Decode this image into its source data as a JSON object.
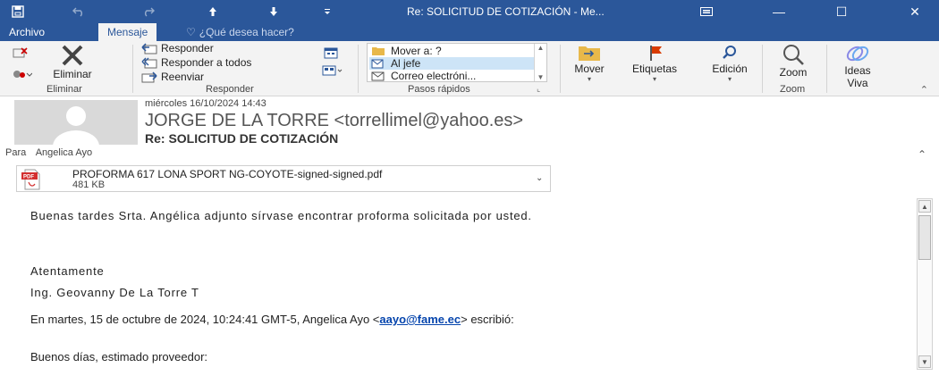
{
  "titlebar": {
    "title": "Re: SOLICITUD DE COTIZACIÓN - Me...",
    "save_icon": "save-icon",
    "undo_icon": "undo-icon",
    "redo_icon": "redo-icon",
    "prev_icon": "arrow-up-icon",
    "next_icon": "arrow-down-icon",
    "qat_icon": "customize-qat-icon",
    "ribbon_display_icon": "ribbon-display-icon",
    "minimize": "—",
    "maximize": "☐",
    "close": "✕"
  },
  "tabs": {
    "archivo": "Archivo",
    "mensaje": "Mensaje",
    "tell_me": "¿Qué desea hacer?"
  },
  "ribbon": {
    "eliminar": {
      "ignore_icon": "ignore-icon",
      "junk_icon": "junk-icon",
      "delete_label": "Eliminar",
      "group_label": "Eliminar"
    },
    "responder": {
      "reply": "Responder",
      "reply_all": "Responder a todos",
      "forward": "Reenviar",
      "group_label": "Responder"
    },
    "pasos_rapidos": {
      "items": [
        "Mover a: ?",
        "Al jefe",
        "Correo electróni..."
      ],
      "group_label": "Pasos rápidos"
    },
    "mover": {
      "label": "Mover"
    },
    "etiquetas": {
      "label": "Etiquetas"
    },
    "edicion": {
      "label": "Edición"
    },
    "zoom": {
      "label": "Zoom",
      "group_label": "Zoom"
    },
    "ideas": {
      "label1": "Ideas",
      "label2": "Viva"
    }
  },
  "header": {
    "date": "miércoles 16/10/2024 14:43",
    "sender": "JORGE DE LA TORRE <torrellimel@yahoo.es>",
    "subject": "Re: SOLICITUD DE COTIZACIÓN",
    "to_label": "Para",
    "to_value": "Angelica Ayo"
  },
  "attachment": {
    "name": "PROFORMA 617 LONA SPORT NG-COYOTE-signed-signed.pdf",
    "size": "481 KB",
    "badge": "PDF"
  },
  "body": {
    "line1": "Buenas tardes Srta. Angélica adjunto sírvase encontrar proforma solicitada por usted.",
    "line2": "Atentamente",
    "line3": "Ing. Geovanny De La Torre T",
    "line4_prefix": "En martes, 15 de octubre de 2024, 10:24:41 GMT-5, Angelica Ayo <",
    "line4_link": "aayo@fame.ec",
    "line4_suffix": "> escribió:",
    "line5": "Buenos días, estimado proveedor:"
  }
}
